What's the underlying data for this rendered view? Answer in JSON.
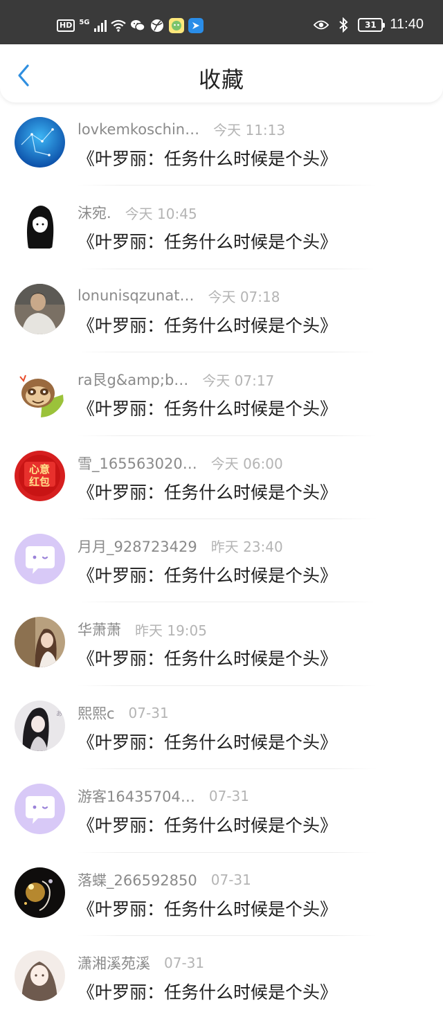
{
  "status_bar": {
    "time": "11:40",
    "battery": "31",
    "network_badge": "HD",
    "network_type": "5G"
  },
  "header": {
    "title": "收藏"
  },
  "items": [
    {
      "name": "lovkemkoschin…",
      "time": "今天 11:13",
      "message": "《叶罗丽：任务什么时候是个头》",
      "avatar": "starry-blue"
    },
    {
      "name": "沫宛.",
      "time": "今天 10:45",
      "message": "《叶罗丽：任务什么时候是个头》",
      "avatar": "anime-girl-black"
    },
    {
      "name": "lonunisqzunat…",
      "time": "今天 07:18",
      "message": "《叶罗丽：任务什么时候是个头》",
      "avatar": "man-photo"
    },
    {
      "name": "ra艮g&amp;b…",
      "time": "今天 07:17",
      "message": "《叶罗丽：任务什么时候是个头》",
      "avatar": "sloth"
    },
    {
      "name": "雪_165563020…",
      "time": "今天 06:00",
      "message": "《叶罗丽：任务什么时候是个头》",
      "avatar": "red-envelope"
    },
    {
      "name": "月月_928723429",
      "time": "昨天 23:40",
      "message": "《叶罗丽：任务什么时候是个头》",
      "avatar": "default-purple"
    },
    {
      "name": "华萧萧",
      "time": "昨天 19:05",
      "message": "《叶罗丽：任务什么时候是个头》",
      "avatar": "woman-photo"
    },
    {
      "name": "熙熙c",
      "time": "07-31",
      "message": "《叶罗丽：任务什么时候是个头》",
      "avatar": "girl-photo"
    },
    {
      "name": "游客16435704…",
      "time": "07-31",
      "message": "《叶罗丽：任务什么时候是个头》",
      "avatar": "default-purple"
    },
    {
      "name": "落蝶_266592850",
      "time": "07-31",
      "message": "《叶罗丽：任务什么时候是个头》",
      "avatar": "dark-art"
    },
    {
      "name": "潇湘溪苑溪",
      "time": "07-31",
      "message": "《叶罗丽：任务什么时候是个头》",
      "avatar": "anime-girl-light"
    }
  ]
}
